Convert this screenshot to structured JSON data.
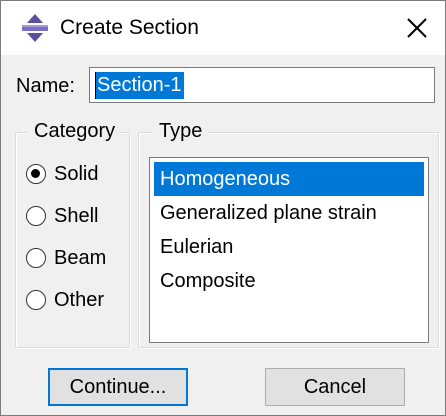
{
  "window": {
    "title": "Create Section",
    "icon": "abaqus-section-icon",
    "close_icon": "close-icon"
  },
  "name_field": {
    "label": "Name:",
    "value": "Section-1"
  },
  "category": {
    "legend": "Category",
    "options": [
      {
        "label": "Solid",
        "checked": true
      },
      {
        "label": "Shell",
        "checked": false
      },
      {
        "label": "Beam",
        "checked": false
      },
      {
        "label": "Other",
        "checked": false
      }
    ]
  },
  "type": {
    "legend": "Type",
    "items": [
      {
        "label": "Homogeneous",
        "selected": true
      },
      {
        "label": "Generalized plane strain",
        "selected": false
      },
      {
        "label": "Eulerian",
        "selected": false
      },
      {
        "label": "Composite",
        "selected": false
      }
    ]
  },
  "buttons": {
    "continue_label": "Continue...",
    "cancel_label": "Cancel"
  },
  "colors": {
    "selection": "#0078d7",
    "dialog_bg": "#f0f0f0",
    "icon_purple": "#5b4f9e"
  }
}
